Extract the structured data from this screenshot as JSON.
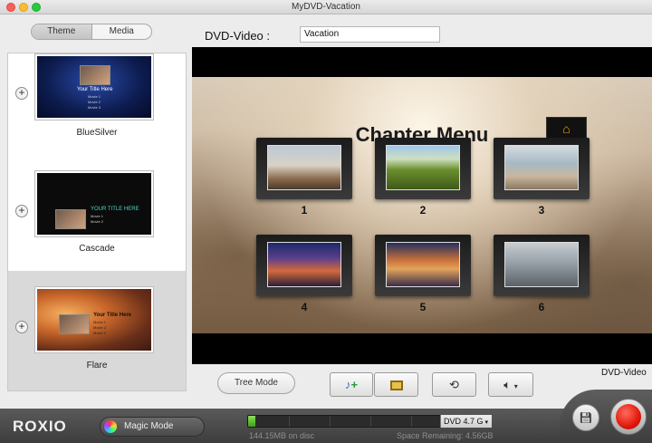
{
  "window": {
    "title": "MyDVD-Vacation"
  },
  "sidebar": {
    "tabs": [
      {
        "label": "Theme",
        "active": true
      },
      {
        "label": "Media",
        "active": false
      }
    ],
    "themes": [
      {
        "name": "BlueSilver",
        "thumb_title": "Your Title Here",
        "thumb_items": [
          "Movie 1",
          "Movie 2",
          "Movie 3"
        ]
      },
      {
        "name": "Cascade",
        "thumb_title": "YOUR TITLE HERE",
        "thumb_items": [
          "Movie 1",
          "Movie 2"
        ]
      },
      {
        "name": "Flare",
        "thumb_title": "Your Title Here",
        "thumb_items": [
          "Movie 1",
          "Movie 2",
          "Movie 3"
        ],
        "selected": true
      }
    ],
    "add_symbol": "+"
  },
  "header": {
    "label": "DVD-Video :",
    "title_value": "Vacation"
  },
  "preview": {
    "menu_title": "Chapter Menu",
    "home_icon": "home-icon",
    "chapters": [
      "1",
      "2",
      "3",
      "4",
      "5",
      "6"
    ]
  },
  "controls": {
    "tree_mode_label": "Tree Mode",
    "add_music_icon": "music-note-plus-icon",
    "add_photo_icon": "photo-frame-icon",
    "loop_icon": "loop-icon",
    "audio_icon": "speaker-icon",
    "format_label": "DVD-Video"
  },
  "footer": {
    "brand": "ROXIO",
    "magic_mode_label": "Magic Mode",
    "disc_type": "DVD 4.7 G",
    "used_text": "144.15MB on disc",
    "remaining_text": "Space Remaining: 4.56GB",
    "used_fraction": 0.03
  },
  "colors": {
    "burn": "#e0180b",
    "capacity": "#5cc22e",
    "home_icon": "#f0a020"
  }
}
